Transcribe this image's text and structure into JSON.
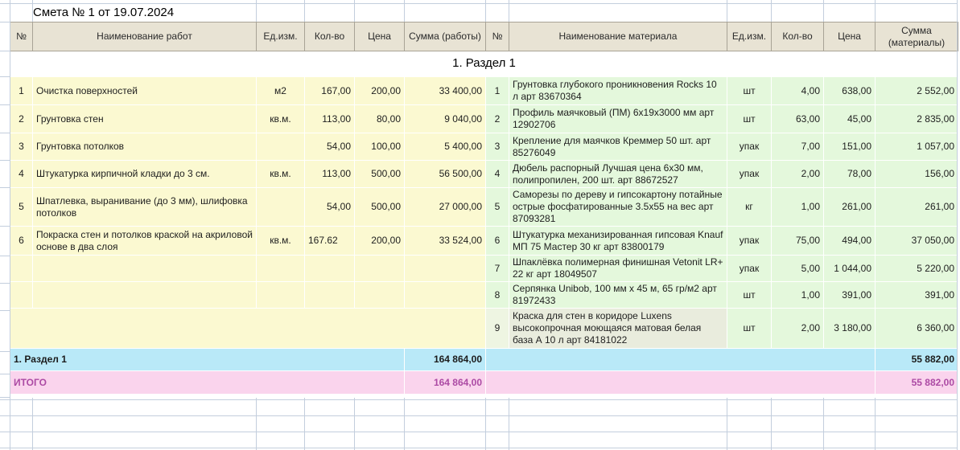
{
  "title": "Смета № 1 от 19.07.2024",
  "section_header": "1. Раздел 1",
  "works_table": {
    "headers": {
      "num": "№",
      "name": "Наименование работ",
      "unit": "Ед.изм.",
      "qty": "Кол-во",
      "price": "Цена",
      "sum": "Сумма (работы)"
    },
    "rows": [
      {
        "num": "1",
        "name": "Очистка поверхностей",
        "unit": "м2",
        "qty": "167,00",
        "price": "200,00",
        "sum": "33 400,00"
      },
      {
        "num": "2",
        "name": "Грунтовка стен",
        "unit": "кв.м.",
        "qty": "113,00",
        "price": "80,00",
        "sum": "9 040,00"
      },
      {
        "num": "3",
        "name": "Грунтовка потолков",
        "unit": "",
        "qty": "54,00",
        "price": "100,00",
        "sum": "5 400,00"
      },
      {
        "num": "4",
        "name": "Штукатурка кирпичной кладки до 3 см.",
        "unit": "кв.м.",
        "qty": "113,00",
        "price": "500,00",
        "sum": "56 500,00"
      },
      {
        "num": "5",
        "name": "Шпатлевка, выранивание (до 3 мм), шлифовка потолков",
        "unit": "",
        "qty": "54,00",
        "price": "500,00",
        "sum": "27 000,00"
      },
      {
        "num": "6",
        "name": "Покраска стен и потолков краской на акриловой основе в два слоя",
        "unit": "кв.м.",
        "qty": "167.62",
        "price": "200,00",
        "sum": "33 524,00"
      }
    ]
  },
  "materials_table": {
    "headers": {
      "num": "№",
      "name": "Наименование материала",
      "unit": "Ед.изм.",
      "qty": "Кол-во",
      "price": "Цена",
      "sum": "Сумма (материалы)"
    },
    "rows": [
      {
        "num": "1",
        "name": "Грунтовка глубокого проникновения Rocks 10 л  арт 83670364",
        "unit": "шт",
        "qty": "4,00",
        "price": "638,00",
        "sum": "2 552,00"
      },
      {
        "num": "2",
        "name": "Профиль маячковый (ПМ) 6х19х3000 мм арт 12902706",
        "unit": "шт",
        "qty": "63,00",
        "price": "45,00",
        "sum": "2 835,00"
      },
      {
        "num": "3",
        "name": "Крепление для маячков Креммер 50 шт. арт 85276049",
        "unit": "упак",
        "qty": "7,00",
        "price": "151,00",
        "sum": "1 057,00"
      },
      {
        "num": "4",
        "name": "Дюбель распорный Лучшая цена 6х30 мм, полипропилен, 200 шт. арт 88672527",
        "unit": "упак",
        "qty": "2,00",
        "price": "78,00",
        "sum": "156,00"
      },
      {
        "num": "5",
        "name": "Саморезы по дереву и гипсокартону потайные острые фосфатированные 3.5х55 на вес арт 87093281",
        "unit": "кг",
        "qty": "1,00",
        "price": "261,00",
        "sum": "261,00"
      },
      {
        "num": "6",
        "name": "Штукатурка механизированная гипсовая Knauf МП 75 Мастер 30 кг арт 83800179",
        "unit": "упак",
        "qty": "75,00",
        "price": "494,00",
        "sum": "37 050,00"
      },
      {
        "num": "7",
        "name": "Шпаклёвка полимерная финишная Vetonit LR+ 22 кг арт 18049507",
        "unit": "упак",
        "qty": "5,00",
        "price": "1 044,00",
        "sum": "5 220,00"
      },
      {
        "num": "8",
        "name": "Серпянка Unibob, 100 мм х 45 м, 65 гр/м2 арт 81972433",
        "unit": "шт",
        "qty": "1,00",
        "price": "391,00",
        "sum": "391,00"
      },
      {
        "num": "9",
        "name": "Краска для стен в коридоре Luxens высокопрочная моющаяся матовая белая база А 10 л арт 84181022",
        "unit": "шт",
        "qty": "2,00",
        "price": "3 180,00",
        "sum": "6 360,00"
      }
    ]
  },
  "totals": {
    "section": {
      "label": "1. Раздел 1",
      "works_sum": "164 864,00",
      "materials_sum": "55 882,00"
    },
    "grand": {
      "label": "ИТОГО",
      "works_sum": "164 864,00",
      "materials_sum": "55 882,00"
    }
  },
  "colors": {
    "works_fill": "#fbf9d1",
    "materials_fill": "#e4f8dc",
    "header_fill": "#e8e3d4",
    "section_total_fill": "#b9e9f8",
    "grand_total_fill": "#fad4ed",
    "grand_total_text": "#ac4aa4",
    "gridline": "#c3cedd"
  }
}
